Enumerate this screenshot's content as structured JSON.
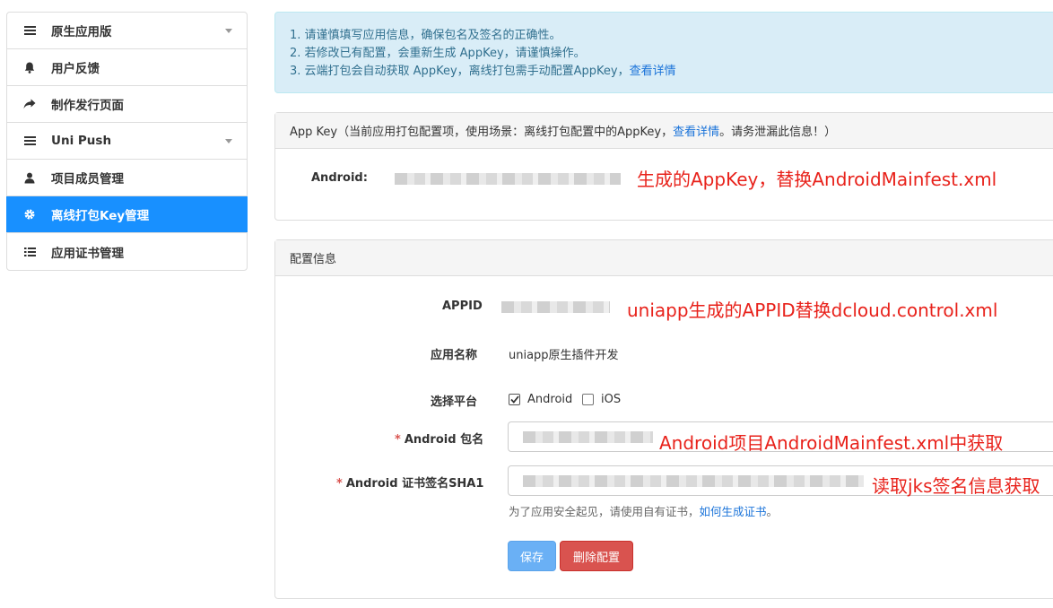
{
  "sidebar": {
    "items": [
      {
        "label": "原生应用版",
        "icon": "list-icon",
        "has_caret": true
      },
      {
        "label": "用户反馈",
        "icon": "bell-icon",
        "has_caret": false
      },
      {
        "label": "制作发行页面",
        "icon": "share-arrow-icon",
        "has_caret": false
      },
      {
        "label": "Uni Push",
        "icon": "list-icon",
        "has_caret": true
      },
      {
        "label": "项目成员管理",
        "icon": "user-icon",
        "has_caret": false
      },
      {
        "label": "离线打包Key管理",
        "icon": "gear-icon",
        "has_caret": false,
        "active": true
      },
      {
        "label": "应用证书管理",
        "icon": "list-lines-icon",
        "has_caret": false
      }
    ]
  },
  "alert": {
    "line1": "1. 请谨慎填写应用信息，确保包名及签名的正确性。",
    "line2": "2. 若修改已有配置，会重新生成 AppKey，请谨慎操作。",
    "line3_prefix": "3. 云端打包会自动获取 AppKey，离线打包需手动配置AppKey，",
    "line3_link": "查看详情"
  },
  "appkey_panel": {
    "heading_prefix": "App Key（当前应用打包配置项，使用场景：离线打包配置中的AppKey，",
    "heading_link": "查看详情",
    "heading_suffix": "。请务泄漏此信息！）",
    "android_label": "Android:",
    "annotation": "生成的AppKey，替换AndroidMainfest.xml"
  },
  "config_panel": {
    "heading": "配置信息",
    "appid_label": "APPID",
    "appid_annotation": "uniapp生成的APPID替换dcloud.control.xml",
    "appname_label": "应用名称",
    "appname_value": "uniapp原生插件开发",
    "platform_label": "选择平台",
    "platform_android": "Android",
    "platform_ios": "iOS",
    "android_checked": true,
    "ios_checked": false,
    "package_required": "*",
    "package_label": "Android 包名",
    "package_annotation": "Android项目AndroidMainfest.xml中获取",
    "sha1_required": "*",
    "sha1_label": "Android 证书签名SHA1",
    "sha1_annotation": "读取jks签名信息获取",
    "help_prefix": "为了应用安全起见，请使用自有证书，",
    "help_link": "如何生成证书",
    "help_suffix": "。",
    "save_button": "保存",
    "delete_button": "删除配置"
  },
  "colors": {
    "active_sidebar": "#1890ff",
    "annotation": "#e8221b",
    "alert_bg": "#d9edf7",
    "danger": "#d9534f",
    "primary": "#6ab0f5"
  }
}
